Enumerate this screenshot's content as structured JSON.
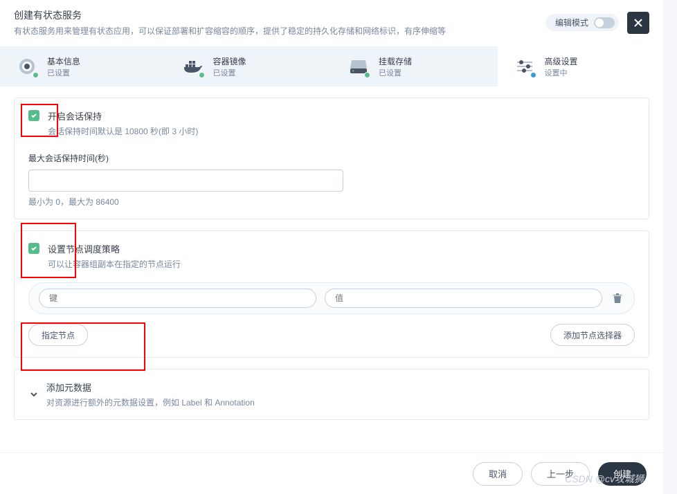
{
  "header": {
    "title": "创建有状态服务",
    "subtitle": "有状态服务用来管理有状态应用，可以保证部署和扩容缩容的顺序，提供了稳定的持久化存储和网络标识，有序伸缩等",
    "toggle_label": "编辑模式"
  },
  "steps": [
    {
      "title": "基本信息",
      "status": "已设置"
    },
    {
      "title": "容器镜像",
      "status": "已设置"
    },
    {
      "title": "挂载存储",
      "status": "已设置"
    },
    {
      "title": "高级设置",
      "status": "设置中"
    }
  ],
  "session": {
    "title": "开启会话保持",
    "desc": "会话保持时间默认是 10800 秒(即 3 小时)",
    "field_label": "最大会话保持时间(秒)",
    "field_hint": "最小为 0，最大为 86400"
  },
  "scheduling": {
    "title": "设置节点调度策略",
    "desc": "可以让容器组副本在指定的节点运行",
    "key_placeholder": "键",
    "value_placeholder": "值",
    "specify_btn": "指定节点",
    "add_selector_btn": "添加节点选择器"
  },
  "metadata": {
    "title": "添加元数据",
    "desc": "对资源进行额外的元数据设置，例如 Label 和 Annotation"
  },
  "footer": {
    "cancel": "取消",
    "prev": "上一步",
    "create": "创建"
  },
  "watermark": "CSDN @cv攻城狮"
}
